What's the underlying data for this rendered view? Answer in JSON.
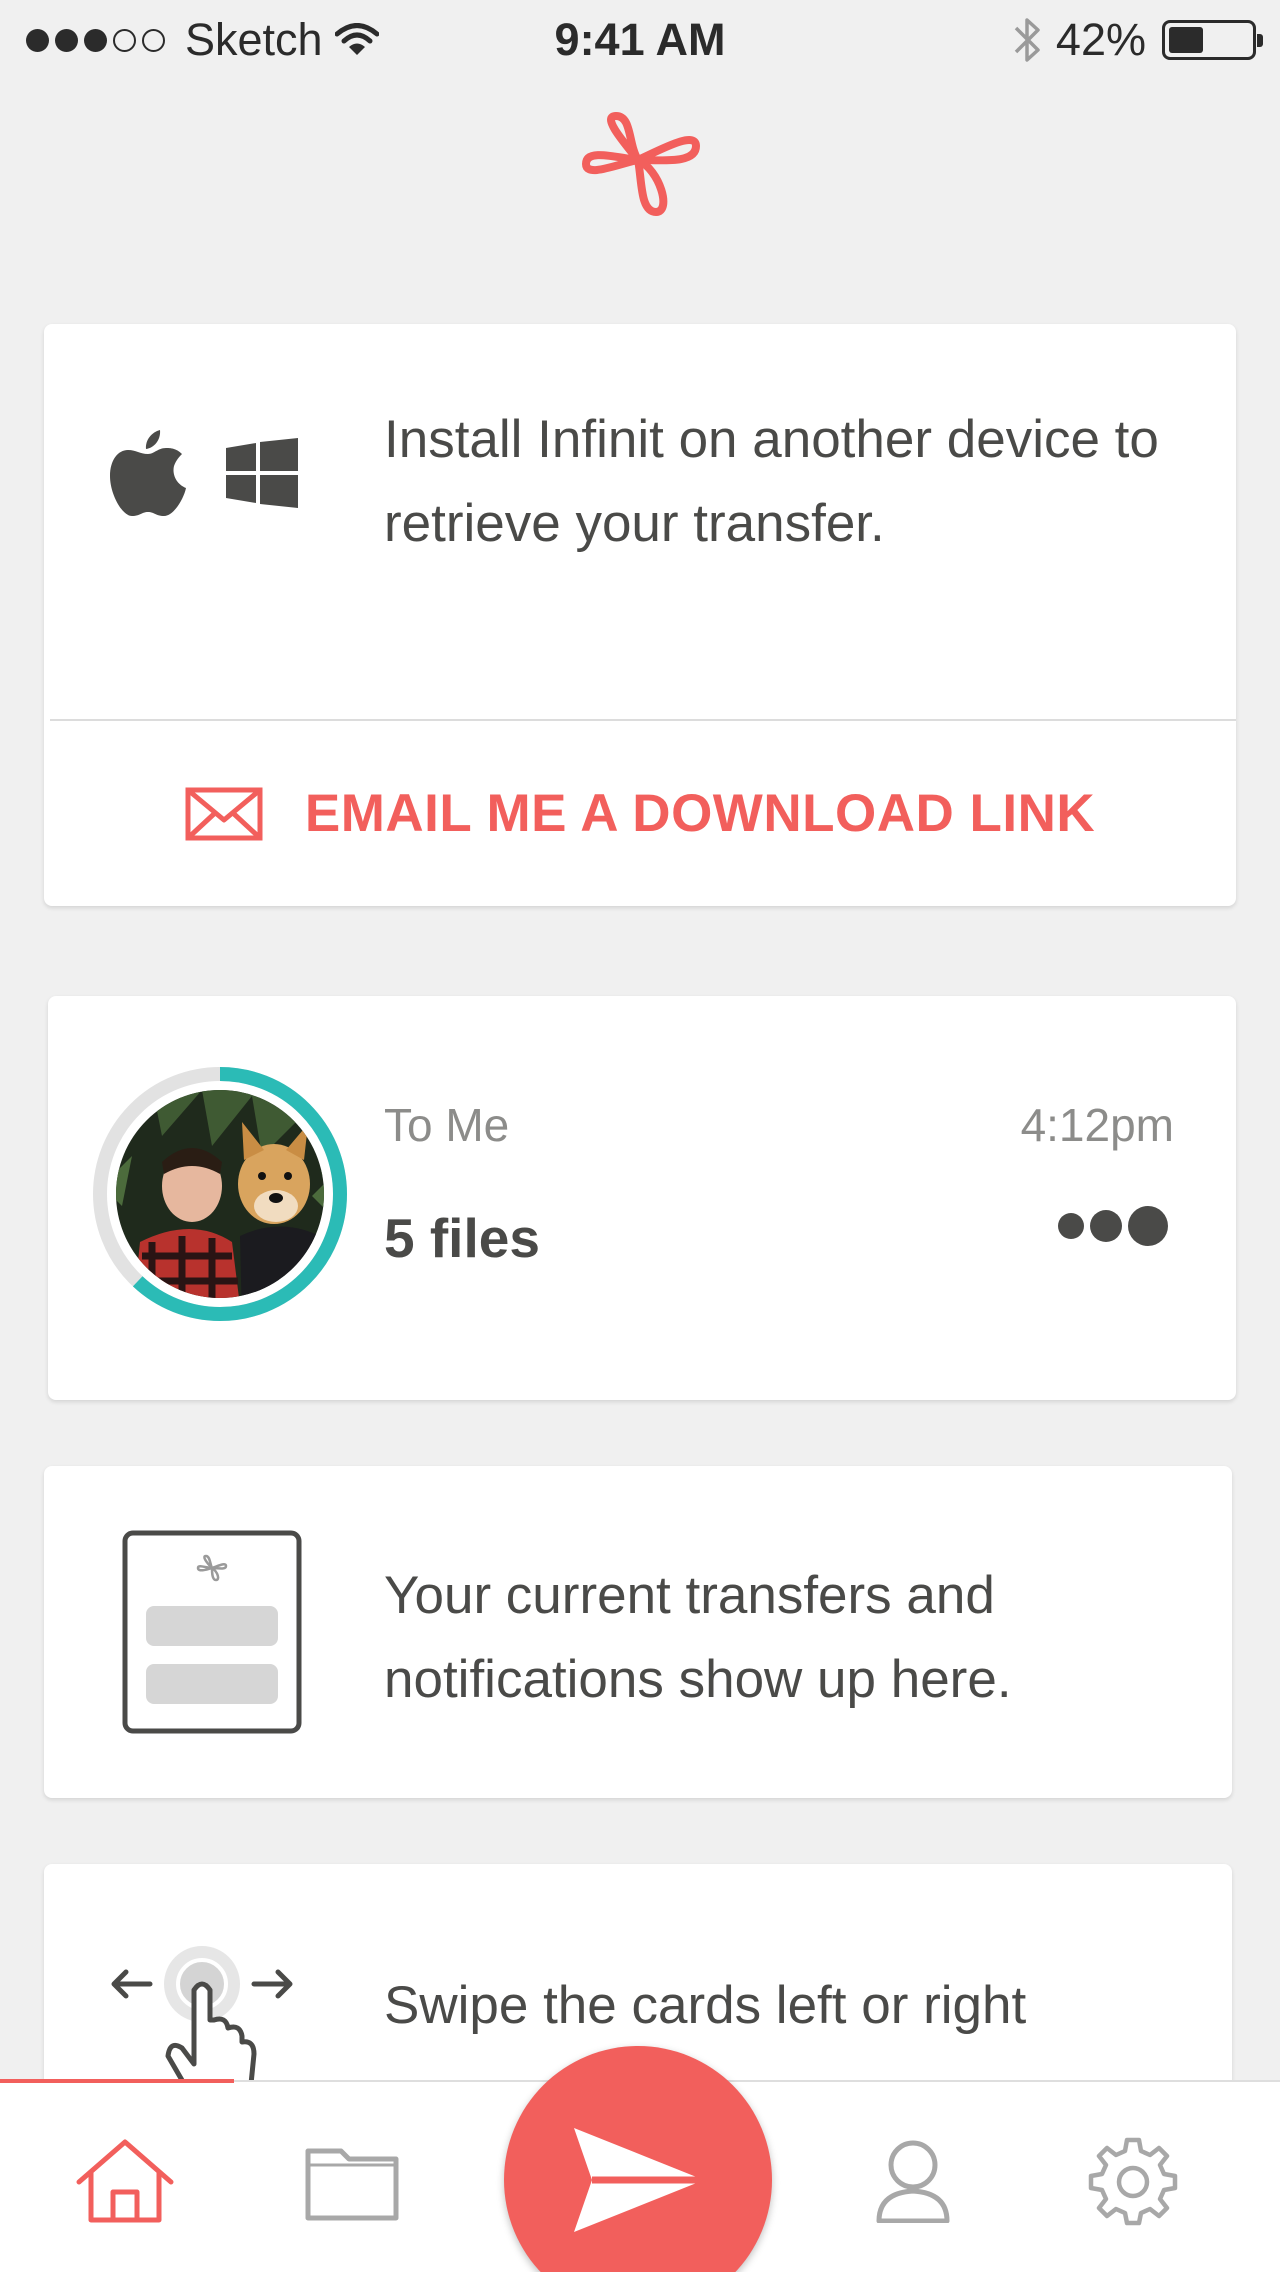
{
  "status_bar": {
    "carrier": "Sketch",
    "time": "9:41 AM",
    "battery_percent": "42%",
    "battery_level": 0.42,
    "signal_bars_filled": 3,
    "signal_bars_total": 5
  },
  "colors": {
    "accent": "#f25f5c",
    "progress": "#2bbbb6",
    "text_dark": "#4a4a48",
    "text_muted": "#8c8c8a"
  },
  "install_card": {
    "message": "Install Infinit on another device to retrieve your transfer.",
    "icons": [
      "apple-icon",
      "windows-icon"
    ],
    "email_label": "EMAIL ME A DOWNLOAD LINK"
  },
  "transfer_card": {
    "recipient": "To Me",
    "time": "4:12pm",
    "files": "5 files",
    "progress": 0.62
  },
  "notify_card": {
    "message": "Your current transfers and notifications show up here."
  },
  "swipe_card": {
    "message": "Swipe the cards left or right"
  },
  "tab_bar": {
    "tabs": [
      "home-icon",
      "folder-icon",
      "send-icon",
      "user-icon",
      "gear-icon"
    ],
    "active": "home"
  }
}
